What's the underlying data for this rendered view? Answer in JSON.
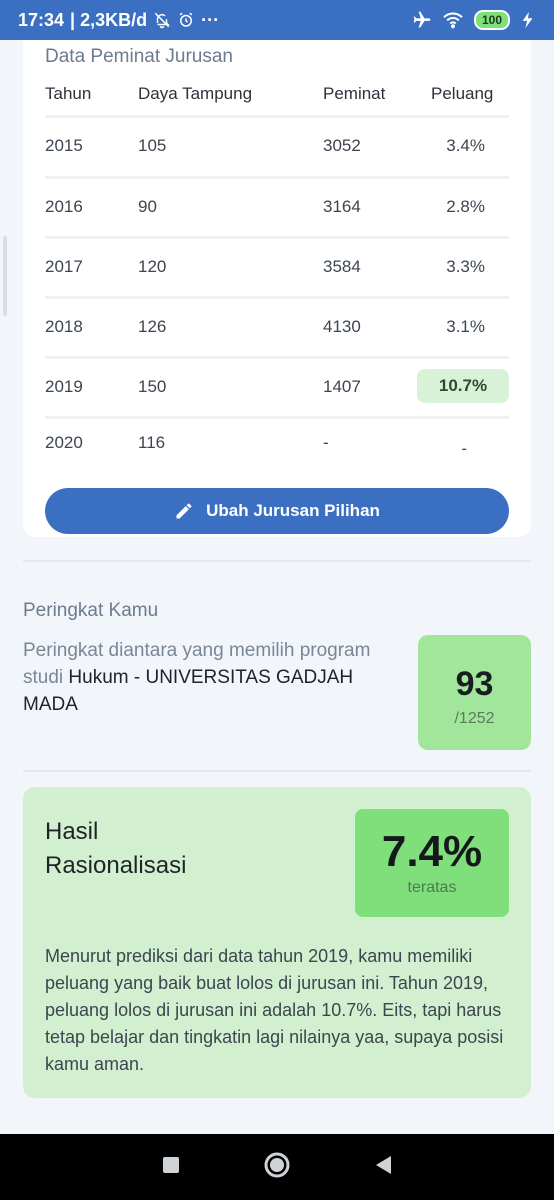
{
  "status_bar": {
    "time": "17:34",
    "speed": "| 2,3KB/d",
    "more": "···",
    "battery": "100"
  },
  "peminat": {
    "title": "Data Peminat Jurusan",
    "headers": [
      "Tahun",
      "Daya Tampung",
      "Peminat",
      "Peluang"
    ],
    "rows": [
      {
        "tahun": "2015",
        "daya": "105",
        "peminat": "3052",
        "peluang": "3.4%"
      },
      {
        "tahun": "2016",
        "daya": "90",
        "peminat": "3164",
        "peluang": "2.8%"
      },
      {
        "tahun": "2017",
        "daya": "120",
        "peminat": "3584",
        "peluang": "3.3%"
      },
      {
        "tahun": "2018",
        "daya": "126",
        "peminat": "4130",
        "peluang": "3.1%"
      },
      {
        "tahun": "2019",
        "daya": "150",
        "peminat": "1407",
        "peluang": "10.7%"
      },
      {
        "tahun": "2020",
        "daya": "116",
        "peminat": "-",
        "peluang": "-"
      }
    ],
    "button_label": "Ubah Jurusan Pilihan"
  },
  "peringkat": {
    "title": "Peringkat Kamu",
    "desc_prefix": "Peringkat diantara yang memilih program studi",
    "program": "Hukum - UNIVERSITAS GADJAH MADA",
    "rank": "93",
    "total": "/1252"
  },
  "hasil": {
    "title": "Hasil Rasionalisasi",
    "percent": "7.4%",
    "percent_label": "teratas",
    "text": "Menurut prediksi dari data tahun 2019, kamu memiliki peluang yang baik buat lolos di jurusan ini. Tahun 2019, peluang lolos di jurusan ini adalah 10.7%. Eits, tapi harus tetap belajar dan tingkatin lagi nilainya yaa, supaya posisi kamu aman."
  },
  "colors": {
    "primary": "#3a6fc2",
    "highlight": "#d8f2d7",
    "rank_box": "#a2e69b",
    "result_bg": "#d2f0d0",
    "percent_box": "#7fdf7a"
  }
}
